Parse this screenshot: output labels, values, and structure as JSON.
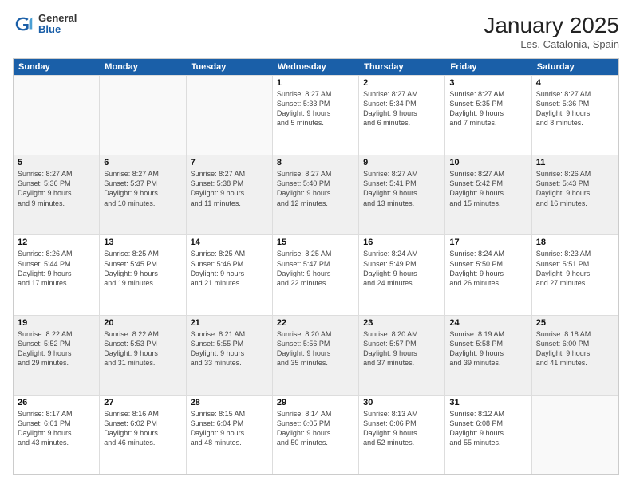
{
  "logo": {
    "general": "General",
    "blue": "Blue"
  },
  "title": "January 2025",
  "location": "Les, Catalonia, Spain",
  "day_headers": [
    "Sunday",
    "Monday",
    "Tuesday",
    "Wednesday",
    "Thursday",
    "Friday",
    "Saturday"
  ],
  "weeks": [
    [
      {
        "num": "",
        "empty": true
      },
      {
        "num": "",
        "empty": true
      },
      {
        "num": "",
        "empty": true
      },
      {
        "num": "1",
        "info": "Sunrise: 8:27 AM\nSunset: 5:33 PM\nDaylight: 9 hours\nand 5 minutes."
      },
      {
        "num": "2",
        "info": "Sunrise: 8:27 AM\nSunset: 5:34 PM\nDaylight: 9 hours\nand 6 minutes."
      },
      {
        "num": "3",
        "info": "Sunrise: 8:27 AM\nSunset: 5:35 PM\nDaylight: 9 hours\nand 7 minutes."
      },
      {
        "num": "4",
        "info": "Sunrise: 8:27 AM\nSunset: 5:36 PM\nDaylight: 9 hours\nand 8 minutes."
      }
    ],
    [
      {
        "num": "5",
        "info": "Sunrise: 8:27 AM\nSunset: 5:36 PM\nDaylight: 9 hours\nand 9 minutes."
      },
      {
        "num": "6",
        "info": "Sunrise: 8:27 AM\nSunset: 5:37 PM\nDaylight: 9 hours\nand 10 minutes."
      },
      {
        "num": "7",
        "info": "Sunrise: 8:27 AM\nSunset: 5:38 PM\nDaylight: 9 hours\nand 11 minutes."
      },
      {
        "num": "8",
        "info": "Sunrise: 8:27 AM\nSunset: 5:40 PM\nDaylight: 9 hours\nand 12 minutes."
      },
      {
        "num": "9",
        "info": "Sunrise: 8:27 AM\nSunset: 5:41 PM\nDaylight: 9 hours\nand 13 minutes."
      },
      {
        "num": "10",
        "info": "Sunrise: 8:27 AM\nSunset: 5:42 PM\nDaylight: 9 hours\nand 15 minutes."
      },
      {
        "num": "11",
        "info": "Sunrise: 8:26 AM\nSunset: 5:43 PM\nDaylight: 9 hours\nand 16 minutes."
      }
    ],
    [
      {
        "num": "12",
        "info": "Sunrise: 8:26 AM\nSunset: 5:44 PM\nDaylight: 9 hours\nand 17 minutes."
      },
      {
        "num": "13",
        "info": "Sunrise: 8:25 AM\nSunset: 5:45 PM\nDaylight: 9 hours\nand 19 minutes."
      },
      {
        "num": "14",
        "info": "Sunrise: 8:25 AM\nSunset: 5:46 PM\nDaylight: 9 hours\nand 21 minutes."
      },
      {
        "num": "15",
        "info": "Sunrise: 8:25 AM\nSunset: 5:47 PM\nDaylight: 9 hours\nand 22 minutes."
      },
      {
        "num": "16",
        "info": "Sunrise: 8:24 AM\nSunset: 5:49 PM\nDaylight: 9 hours\nand 24 minutes."
      },
      {
        "num": "17",
        "info": "Sunrise: 8:24 AM\nSunset: 5:50 PM\nDaylight: 9 hours\nand 26 minutes."
      },
      {
        "num": "18",
        "info": "Sunrise: 8:23 AM\nSunset: 5:51 PM\nDaylight: 9 hours\nand 27 minutes."
      }
    ],
    [
      {
        "num": "19",
        "info": "Sunrise: 8:22 AM\nSunset: 5:52 PM\nDaylight: 9 hours\nand 29 minutes."
      },
      {
        "num": "20",
        "info": "Sunrise: 8:22 AM\nSunset: 5:53 PM\nDaylight: 9 hours\nand 31 minutes."
      },
      {
        "num": "21",
        "info": "Sunrise: 8:21 AM\nSunset: 5:55 PM\nDaylight: 9 hours\nand 33 minutes."
      },
      {
        "num": "22",
        "info": "Sunrise: 8:20 AM\nSunset: 5:56 PM\nDaylight: 9 hours\nand 35 minutes."
      },
      {
        "num": "23",
        "info": "Sunrise: 8:20 AM\nSunset: 5:57 PM\nDaylight: 9 hours\nand 37 minutes."
      },
      {
        "num": "24",
        "info": "Sunrise: 8:19 AM\nSunset: 5:58 PM\nDaylight: 9 hours\nand 39 minutes."
      },
      {
        "num": "25",
        "info": "Sunrise: 8:18 AM\nSunset: 6:00 PM\nDaylight: 9 hours\nand 41 minutes."
      }
    ],
    [
      {
        "num": "26",
        "info": "Sunrise: 8:17 AM\nSunset: 6:01 PM\nDaylight: 9 hours\nand 43 minutes."
      },
      {
        "num": "27",
        "info": "Sunrise: 8:16 AM\nSunset: 6:02 PM\nDaylight: 9 hours\nand 46 minutes."
      },
      {
        "num": "28",
        "info": "Sunrise: 8:15 AM\nSunset: 6:04 PM\nDaylight: 9 hours\nand 48 minutes."
      },
      {
        "num": "29",
        "info": "Sunrise: 8:14 AM\nSunset: 6:05 PM\nDaylight: 9 hours\nand 50 minutes."
      },
      {
        "num": "30",
        "info": "Sunrise: 8:13 AM\nSunset: 6:06 PM\nDaylight: 9 hours\nand 52 minutes."
      },
      {
        "num": "31",
        "info": "Sunrise: 8:12 AM\nSunset: 6:08 PM\nDaylight: 9 hours\nand 55 minutes."
      },
      {
        "num": "",
        "empty": true
      }
    ]
  ]
}
